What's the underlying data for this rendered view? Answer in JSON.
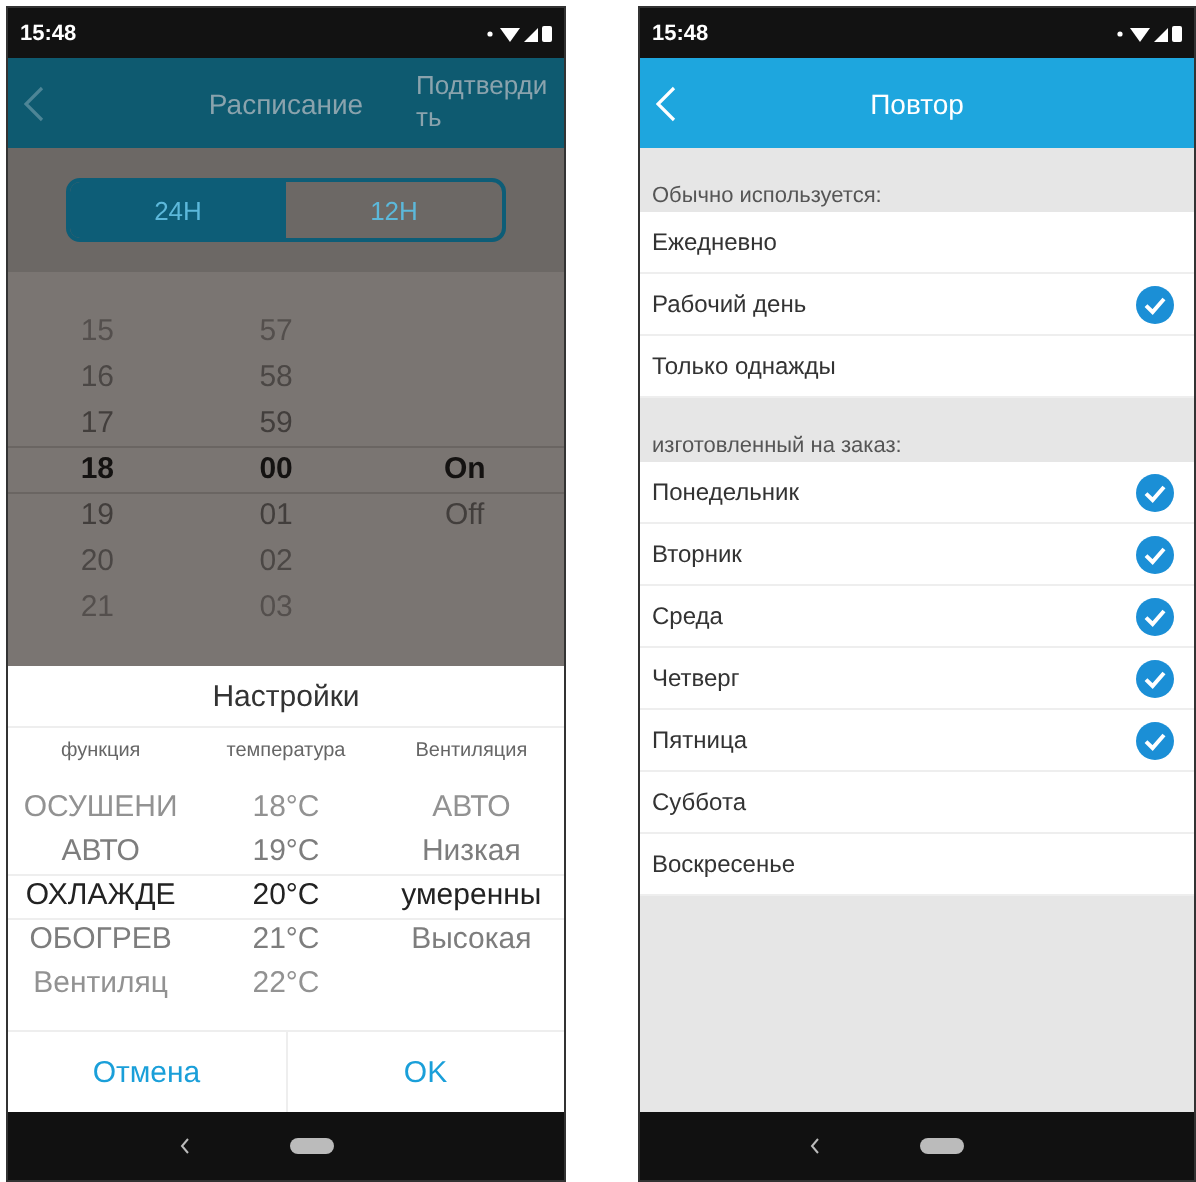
{
  "left_screen": {
    "status_bar": {
      "time": "15:48"
    },
    "header": {
      "title": "Расписание",
      "confirm": "Подтвердить"
    },
    "format_toggle": [
      {
        "label": "24H",
        "selected": true
      },
      {
        "label": "12H",
        "selected": false
      }
    ],
    "time_picker": {
      "columns": [
        {
          "items": [
            {
              "text": "15",
              "selected": false
            },
            {
              "text": "16",
              "selected": false
            },
            {
              "text": "17",
              "selected": false
            },
            {
              "text": "18",
              "selected": true
            },
            {
              "text": "19",
              "selected": false
            },
            {
              "text": "20",
              "selected": false
            },
            {
              "text": "21",
              "selected": false
            }
          ]
        },
        {
          "items": [
            {
              "text": "57",
              "selected": false
            },
            {
              "text": "58",
              "selected": false
            },
            {
              "text": "59",
              "selected": false
            },
            {
              "text": "00",
              "selected": true
            },
            {
              "text": "01",
              "selected": false
            },
            {
              "text": "02",
              "selected": false
            },
            {
              "text": "03",
              "selected": false
            }
          ]
        },
        {
          "items": [
            {
              "text": "On",
              "selected": true
            },
            {
              "text": "Off",
              "selected": false
            }
          ]
        }
      ]
    },
    "dialog": {
      "title": "Настройки",
      "columns": [
        {
          "heading": "функция",
          "items": [
            {
              "text": "ОСУШЕНИ",
              "selected": false
            },
            {
              "text": "АВТО",
              "selected": false
            },
            {
              "text": "ОХЛАЖДЕ",
              "selected": true
            },
            {
              "text": "ОБОГРЕВ",
              "selected": false
            },
            {
              "text": "Вентиляц",
              "selected": false
            }
          ]
        },
        {
          "heading": "температура",
          "items": [
            {
              "text": "18°C",
              "selected": false
            },
            {
              "text": "19°C",
              "selected": false
            },
            {
              "text": "20°C",
              "selected": true
            },
            {
              "text": "21°C",
              "selected": false
            },
            {
              "text": "22°C",
              "selected": false
            }
          ]
        },
        {
          "heading": "Вентиляция",
          "items": [
            {
              "text": "АВТО",
              "selected": false
            },
            {
              "text": "Низкая",
              "selected": false
            },
            {
              "text": "умеренны",
              "selected": true
            },
            {
              "text": "Высокая",
              "selected": false
            }
          ]
        }
      ],
      "buttons": [
        "Отмена",
        "OK"
      ]
    }
  },
  "right_screen": {
    "status_bar": {
      "time": "15:48"
    },
    "header": {
      "title": "Повтор"
    },
    "sections": [
      {
        "label": "Обычно используется:",
        "items": [
          {
            "label": "Ежедневно",
            "checked": false
          },
          {
            "label": "Рабочий день",
            "checked": true
          },
          {
            "label": "Только однажды",
            "checked": false
          }
        ]
      },
      {
        "label": "изготовленный на заказ:",
        "items": [
          {
            "label": "Понедельник",
            "checked": true
          },
          {
            "label": "Вторник",
            "checked": true
          },
          {
            "label": "Среда",
            "checked": true
          },
          {
            "label": "Четверг",
            "checked": true
          },
          {
            "label": "Пятница",
            "checked": true
          },
          {
            "label": "Суббота",
            "checked": false
          },
          {
            "label": "Воскресенье",
            "checked": false
          }
        ]
      }
    ]
  }
}
